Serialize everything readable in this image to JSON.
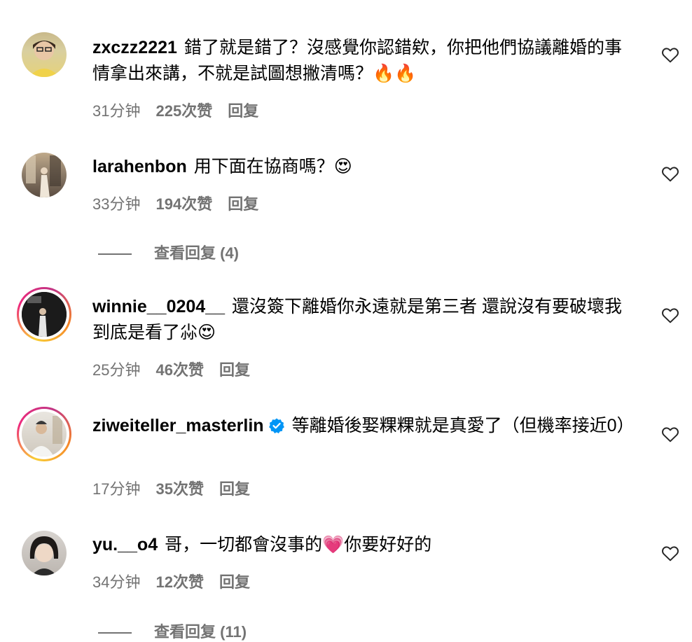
{
  "comments": [
    {
      "username": "zxczz2221",
      "text": "錯了就是錯了？沒感覺你認錯欸，你把他們協議離婚的事情拿出來講，不就是試圖想撇清嗎？🔥🔥",
      "time": "31分钟",
      "likes": "225次赞",
      "reply": "回复",
      "verified": false
    },
    {
      "username": "larahenbon",
      "text": "用下面在協商嗎？😍",
      "time": "33分钟",
      "likes": "194次赞",
      "reply": "回复",
      "verified": false,
      "view_replies": "查看回复 (4)"
    },
    {
      "username": "winnie__0204__",
      "text": "還沒簽下離婚你永遠就是第三者 還說沒有要破壞我到底是看了尛😍",
      "time": "25分钟",
      "likes": "46次赞",
      "reply": "回复",
      "verified": false
    },
    {
      "username": "ziweiteller_masterlin",
      "text": "等離婚後娶粿粿就是真愛了（但機率接近0）",
      "time": "17分钟",
      "likes": "35次赞",
      "reply": "回复",
      "verified": true
    },
    {
      "username": "yu.__o4",
      "text": "哥，一切都會沒事的💗你要好好的",
      "time": "34分钟",
      "likes": "12次赞",
      "reply": "回复",
      "verified": false,
      "view_replies": "查看回复 (11)"
    }
  ],
  "colors": {
    "meta": "#737373",
    "verified": "#0095f6",
    "story_ring": "#ee2a7b"
  }
}
